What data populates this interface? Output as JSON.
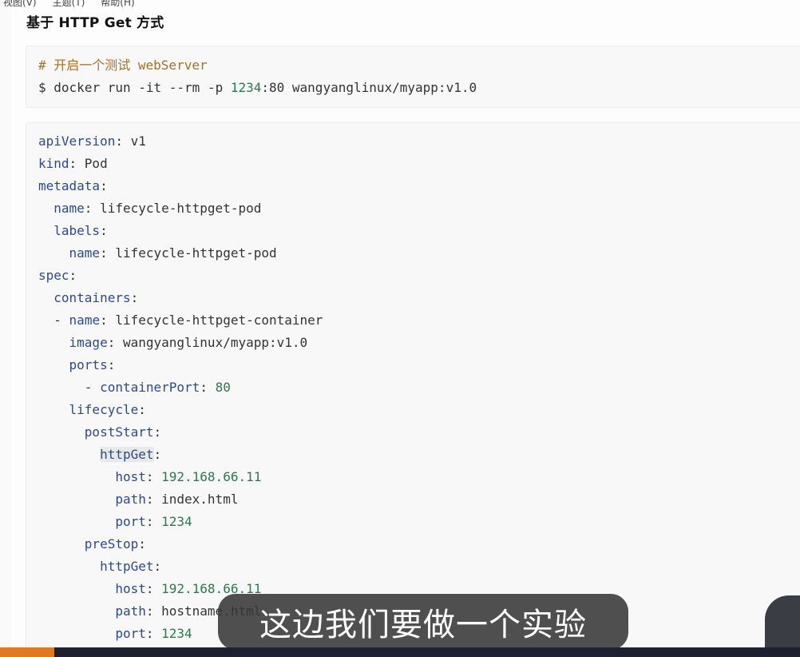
{
  "menubar": {
    "items": [
      "视图(V)",
      "主题(T)",
      "帮助(H)"
    ]
  },
  "heading": "基于 HTTP Get 方式",
  "command_block": {
    "comment": "# 开启一个测试 webServer",
    "prompt": "$",
    "command": "docker run -it --rm -p",
    "port_mapping_num": "1234",
    "port_mapping_rest": ":80 wangyanglinux/myapp:v1.0"
  },
  "yaml": {
    "l1_key": "apiVersion",
    "l1_val": "v1",
    "l2_key": "kind",
    "l2_val": "Pod",
    "l3_key": "metadata",
    "l4_key": "name",
    "l4_val": "lifecycle-httpget-pod",
    "l5_key": "labels",
    "l6_key": "name",
    "l6_val": "lifecycle-httpget-pod",
    "l7_key": "spec",
    "l8_key": "containers",
    "l9_dash": "-",
    "l9_key": "name",
    "l9_val": "lifecycle-httpget-container",
    "l10_key": "image",
    "l10_val": "wangyanglinux/myapp:v1.0",
    "l11_key": "ports",
    "l12_dash": "-",
    "l12_key": "containerPort",
    "l12_val": "80",
    "l13_key": "lifecycle",
    "l14_key": "postStart",
    "l15_key": "httpGet",
    "l16_key": "host",
    "l16_val": "192.168.66.11",
    "l17_key": "path",
    "l17_val": "index.html",
    "l18_key": "port",
    "l18_val": "1234",
    "l19_key": "preStop",
    "l20_key": "httpGet",
    "l21_key": "host",
    "l21_val": "192.168.66.11",
    "l22_key": "path",
    "l22_val": "hostname.html",
    "l23_key": "port",
    "l23_val": "1234"
  },
  "subtitle": "这边我们要做一个实验"
}
